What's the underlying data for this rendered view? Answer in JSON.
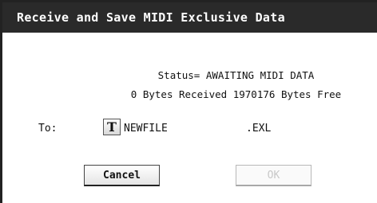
{
  "dialog": {
    "title": "Receive and Save MIDI Exclusive Data",
    "status_text": "Status= AWAITING MIDI DATA",
    "bytes_text": "0 Bytes Received 1970176 Bytes Free",
    "to_label": "To:",
    "text_edit_icon_label": "T",
    "filename_value": "NEWFILE",
    "extension": ".EXL",
    "cancel_label": "Cancel",
    "ok_label": "OK"
  },
  "colors": {
    "titlebar_bg": "#2a2a2a",
    "titlebar_text": "#ffffff",
    "disabled_text": "#c8c8c8"
  }
}
